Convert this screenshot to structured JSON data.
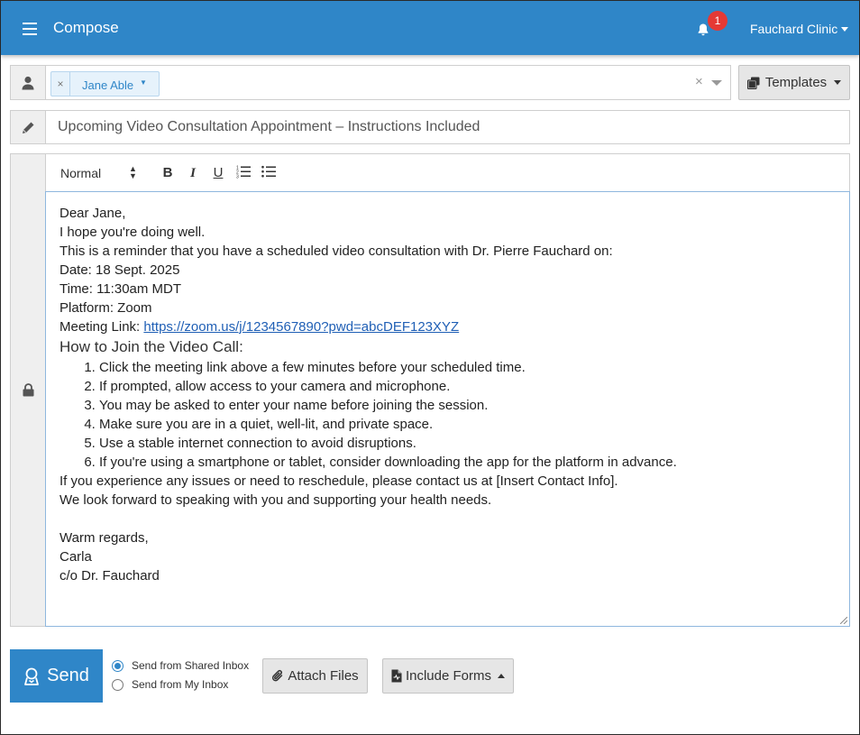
{
  "header": {
    "title": "Compose",
    "notification_count": "1",
    "clinic_name": "Fauchard Clinic"
  },
  "recipients": {
    "tags": [
      {
        "name": "Jane Able"
      }
    ],
    "clear_symbol": "×",
    "remove_symbol": "×"
  },
  "templates_label": "Templates",
  "subject": {
    "value": "Upcoming Video Consultation Appointment – Instructions Included"
  },
  "toolbar": {
    "format_value": "Normal"
  },
  "message": {
    "greeting": "Dear Jane,",
    "line1": "I hope you're doing well.",
    "line2": "This is a reminder that you have a scheduled video consultation with Dr. Pierre Fauchard on:",
    "date": "Date: 18 Sept. 2025",
    "time": "Time: 11:30am MDT",
    "platform": "Platform: Zoom",
    "link_label": "Meeting Link: ",
    "link_url": "https://zoom.us/j/1234567890?pwd=abcDEF123XYZ",
    "heading": "How to Join the Video Call:",
    "steps": [
      "Click the meeting link above a few minutes before your scheduled time.",
      "If prompted, allow access to your camera and microphone.",
      "You may be asked to enter your name before joining the session.",
      "Make sure you are in a quiet, well-lit, and private space.",
      "Use a stable internet connection to avoid disruptions.",
      "If you're using a smartphone or tablet, consider downloading the app for the platform in advance."
    ],
    "issues": "If you experience any issues or need to reschedule, please contact us at [Insert Contact Info].",
    "closing_line": "We look forward to speaking with you and supporting your health needs.",
    "signoff": "Warm regards,",
    "signer": "Carla",
    "signer_org": "c/o Dr. Fauchard"
  },
  "footer": {
    "send_label": "Send",
    "send_from_shared": "Send from Shared Inbox",
    "send_from_mine": "Send from My Inbox",
    "attach_label": "Attach Files",
    "include_forms_label": "Include Forms"
  },
  "colors": {
    "accent": "#2f86c8",
    "badge": "#e53935"
  }
}
